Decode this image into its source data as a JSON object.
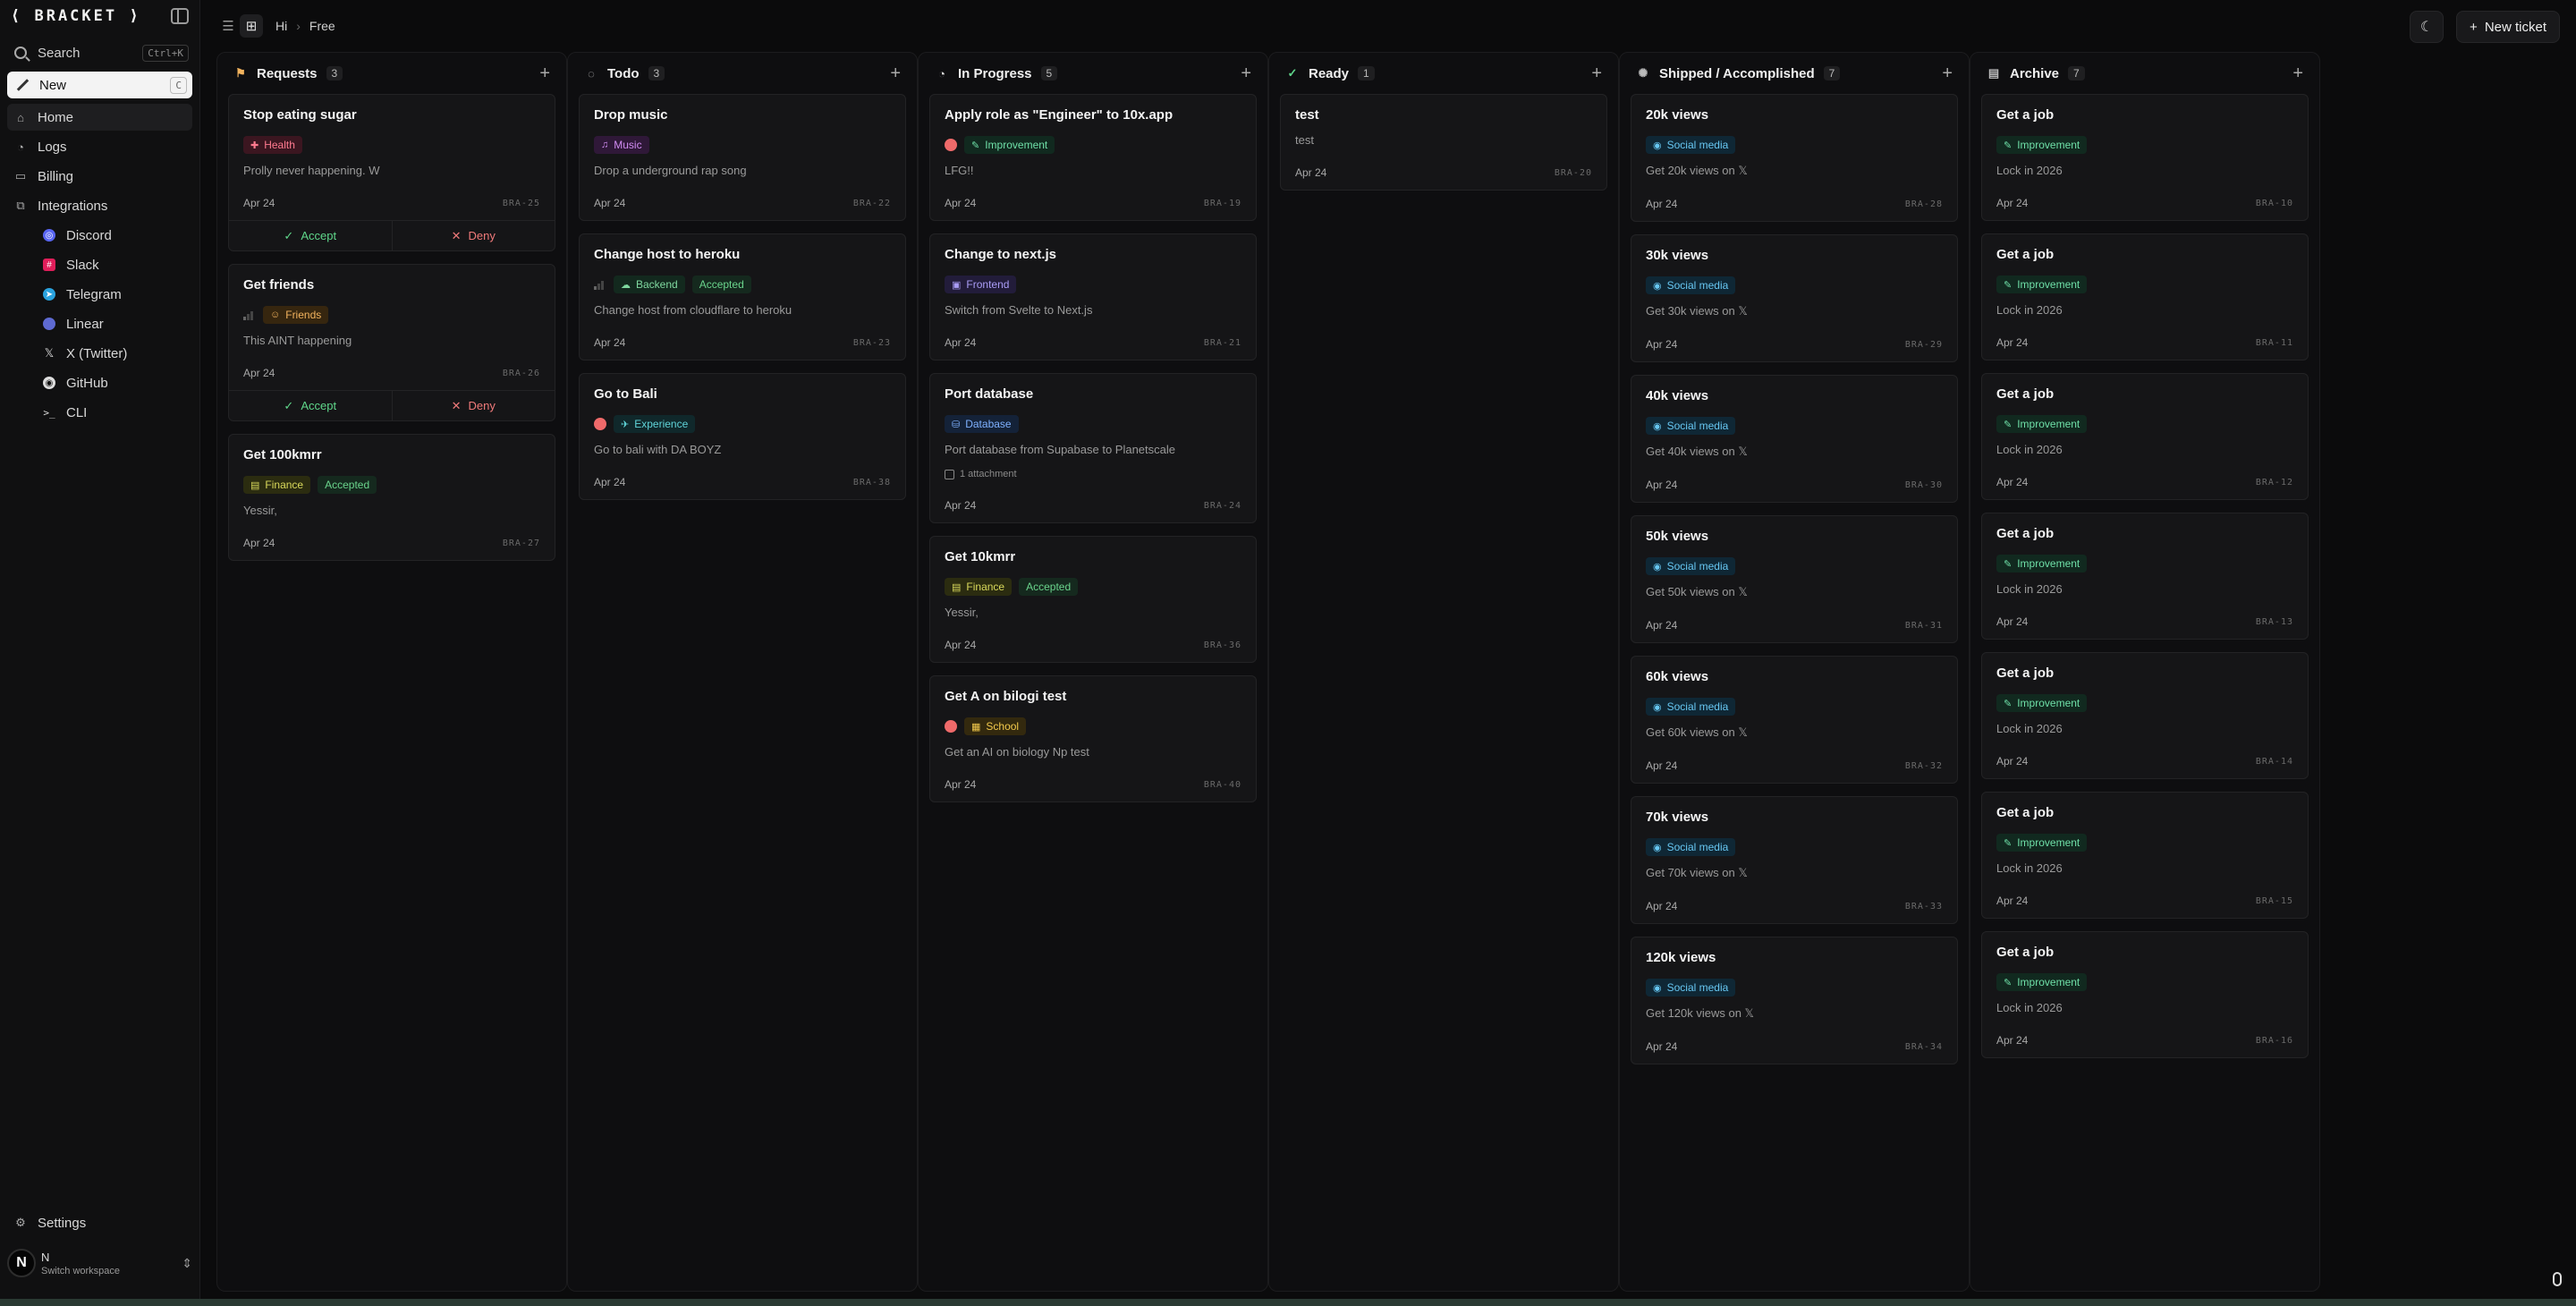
{
  "brand": "⟨ BRACKET ⟩",
  "sidebar": {
    "search_label": "Search",
    "search_kbd": "Ctrl+K",
    "new_label": "New",
    "new_kbd": "C",
    "nav": [
      {
        "label": "Home",
        "icon": "home-icon"
      },
      {
        "label": "Logs",
        "icon": "logs-icon"
      },
      {
        "label": "Billing",
        "icon": "billing-icon"
      },
      {
        "label": "Integrations",
        "icon": "integrations-icon"
      }
    ],
    "integrations": [
      {
        "label": "Discord",
        "icon": "discord-icon",
        "color": "#5865f2"
      },
      {
        "label": "Slack",
        "icon": "slack-icon",
        "color": "#e01e5a"
      },
      {
        "label": "Telegram",
        "icon": "telegram-icon",
        "color": "#2aa3df"
      },
      {
        "label": "Linear",
        "icon": "linear-icon",
        "color": "#5e6ad2"
      },
      {
        "label": "X (Twitter)",
        "icon": "x-icon",
        "color": "#dddddd"
      },
      {
        "label": "GitHub",
        "icon": "github-icon",
        "color": "#dddddd"
      },
      {
        "label": "CLI",
        "icon": "terminal-icon",
        "color": "#dddddd"
      }
    ],
    "settings_label": "Settings",
    "workspace": {
      "avatar": "N",
      "name": "N",
      "sub": "Switch workspace"
    }
  },
  "topbar": {
    "crumbs": [
      "Hi",
      "Free"
    ],
    "new_ticket": "New ticket"
  },
  "columns": [
    {
      "title": "Requests",
      "count": "3",
      "icon": "requests-icon",
      "cards": [
        {
          "title": "Stop eating sugar",
          "prio": "none",
          "tags": [
            {
              "label": "Health",
              "cls": "t-health",
              "icon": "health-icon"
            }
          ],
          "desc": "Prolly never happening. W",
          "date": "Apr 24",
          "id": "BRA-25",
          "accept": "Accept",
          "deny": "Deny"
        },
        {
          "title": "Get friends",
          "prio": "bars",
          "tags": [
            {
              "label": "Friends",
              "cls": "t-friends",
              "icon": "friends-icon"
            }
          ],
          "desc": "This AINT happening",
          "date": "Apr 24",
          "id": "BRA-26",
          "accept": "Accept",
          "deny": "Deny"
        },
        {
          "title": "Get 100kmrr",
          "prio": "none",
          "tags": [
            {
              "label": "Finance",
              "cls": "t-fin",
              "icon": "finance-icon"
            },
            {
              "label": "Accepted",
              "cls": "t-accepted"
            }
          ],
          "desc": "Yessir,",
          "date": "Apr 24",
          "id": "BRA-27"
        }
      ]
    },
    {
      "title": "Todo",
      "count": "3",
      "icon": "todo-icon",
      "cards": [
        {
          "title": "Drop music",
          "prio": "none",
          "tags": [
            {
              "label": "Music",
              "cls": "t-music",
              "icon": "music-icon"
            }
          ],
          "desc": "Drop a underground rap song",
          "date": "Apr 24",
          "id": "BRA-22"
        },
        {
          "title": "Change host to heroku",
          "prio": "bars",
          "tags": [
            {
              "label": "Backend",
              "cls": "t-backend",
              "icon": "backend-icon"
            },
            {
              "label": "Accepted",
              "cls": "t-accepted"
            }
          ],
          "desc": "Change host from cloudflare to heroku",
          "date": "Apr 24",
          "id": "BRA-23"
        },
        {
          "title": "Go to Bali",
          "prio": "red",
          "tags": [
            {
              "label": "Experience",
              "cls": "t-exp",
              "icon": "experience-icon"
            }
          ],
          "desc": "Go to bali with DA BOYZ",
          "date": "Apr 24",
          "id": "BRA-38"
        }
      ]
    },
    {
      "title": "In Progress",
      "count": "5",
      "icon": "in-progress-icon",
      "cards": [
        {
          "title": "Apply role as \"Engineer\" to 10x.app",
          "prio": "red",
          "tags": [
            {
              "label": "Improvement",
              "cls": "t-impr",
              "icon": "wrench-icon"
            }
          ],
          "desc": "LFG!!",
          "date": "Apr 24",
          "id": "BRA-19"
        },
        {
          "title": "Change to next.js",
          "prio": "none",
          "tags": [
            {
              "label": "Frontend",
              "cls": "t-frontend",
              "icon": "frontend-icon"
            }
          ],
          "desc": "Switch from Svelte to Next.js",
          "date": "Apr 24",
          "id": "BRA-21"
        },
        {
          "title": "Port database",
          "prio": "none",
          "tags": [
            {
              "label": "Database",
              "cls": "t-db",
              "icon": "database-icon"
            }
          ],
          "desc": "Port database from Supabase to Planetscale",
          "attachment": "1 attachment",
          "date": "Apr 24",
          "id": "BRA-24"
        },
        {
          "title": "Get 10kmrr",
          "prio": "none",
          "tags": [
            {
              "label": "Finance",
              "cls": "t-fin",
              "icon": "finance-icon"
            },
            {
              "label": "Accepted",
              "cls": "t-accepted"
            }
          ],
          "desc": "Yessir,",
          "date": "Apr 24",
          "id": "BRA-36"
        },
        {
          "title": "Get A on bilogi test",
          "prio": "red",
          "tags": [
            {
              "label": "School",
              "cls": "t-school",
              "icon": "school-icon"
            }
          ],
          "desc": "Get an AI on biology Np test",
          "date": "Apr 24",
          "id": "BRA-40"
        }
      ]
    },
    {
      "title": "Ready",
      "count": "1",
      "icon": "ready-icon",
      "cards": [
        {
          "title": "test",
          "prio": "none",
          "tags": [],
          "desc": "test",
          "date": "Apr 24",
          "id": "BRA-20"
        }
      ]
    },
    {
      "title": "Shipped / Accomplished",
      "count": "7",
      "icon": "shipped-icon",
      "cards": [
        {
          "title": "20k views",
          "prio": "none",
          "tags": [
            {
              "label": "Social media",
              "cls": "t-social",
              "icon": "social-icon"
            }
          ],
          "desc": "Get 20k views on 𝕏",
          "date": "Apr 24",
          "id": "BRA-28"
        },
        {
          "title": "30k views",
          "prio": "none",
          "tags": [
            {
              "label": "Social media",
              "cls": "t-social",
              "icon": "social-icon"
            }
          ],
          "desc": "Get 30k views on 𝕏",
          "date": "Apr 24",
          "id": "BRA-29"
        },
        {
          "title": "40k views",
          "prio": "none",
          "tags": [
            {
              "label": "Social media",
              "cls": "t-social",
              "icon": "social-icon"
            }
          ],
          "desc": "Get 40k views on 𝕏",
          "date": "Apr 24",
          "id": "BRA-30"
        },
        {
          "title": "50k views",
          "prio": "none",
          "tags": [
            {
              "label": "Social media",
              "cls": "t-social",
              "icon": "social-icon"
            }
          ],
          "desc": "Get 50k views on 𝕏",
          "date": "Apr 24",
          "id": "BRA-31"
        },
        {
          "title": "60k views",
          "prio": "none",
          "tags": [
            {
              "label": "Social media",
              "cls": "t-social",
              "icon": "social-icon"
            }
          ],
          "desc": "Get 60k views on 𝕏",
          "date": "Apr 24",
          "id": "BRA-32"
        },
        {
          "title": "70k views",
          "prio": "none",
          "tags": [
            {
              "label": "Social media",
              "cls": "t-social",
              "icon": "social-icon"
            }
          ],
          "desc": "Get 70k views on 𝕏",
          "date": "Apr 24",
          "id": "BRA-33"
        },
        {
          "title": "120k views",
          "prio": "none",
          "tags": [
            {
              "label": "Social media",
              "cls": "t-social",
              "icon": "social-icon"
            }
          ],
          "desc": "Get 120k views on 𝕏",
          "date": "Apr 24",
          "id": "BRA-34"
        }
      ]
    },
    {
      "title": "Archive",
      "count": "7",
      "icon": "archive-icon",
      "cards": [
        {
          "title": "Get a job",
          "prio": "none",
          "tags": [
            {
              "label": "Improvement",
              "cls": "t-impr",
              "icon": "wrench-icon"
            }
          ],
          "desc": "Lock in 2026",
          "date": "Apr 24",
          "id": "BRA-10"
        },
        {
          "title": "Get a job",
          "prio": "none",
          "tags": [
            {
              "label": "Improvement",
              "cls": "t-impr",
              "icon": "wrench-icon"
            }
          ],
          "desc": "Lock in 2026",
          "date": "Apr 24",
          "id": "BRA-11"
        },
        {
          "title": "Get a job",
          "prio": "none",
          "tags": [
            {
              "label": "Improvement",
              "cls": "t-impr",
              "icon": "wrench-icon"
            }
          ],
          "desc": "Lock in 2026",
          "date": "Apr 24",
          "id": "BRA-12"
        },
        {
          "title": "Get a job",
          "prio": "none",
          "tags": [
            {
              "label": "Improvement",
              "cls": "t-impr",
              "icon": "wrench-icon"
            }
          ],
          "desc": "Lock in 2026",
          "date": "Apr 24",
          "id": "BRA-13"
        },
        {
          "title": "Get a job",
          "prio": "none",
          "tags": [
            {
              "label": "Improvement",
              "cls": "t-impr",
              "icon": "wrench-icon"
            }
          ],
          "desc": "Lock in 2026",
          "date": "Apr 24",
          "id": "BRA-14"
        },
        {
          "title": "Get a job",
          "prio": "none",
          "tags": [
            {
              "label": "Improvement",
              "cls": "t-impr",
              "icon": "wrench-icon"
            }
          ],
          "desc": "Lock in 2026",
          "date": "Apr 24",
          "id": "BRA-15"
        },
        {
          "title": "Get a job",
          "prio": "none",
          "tags": [
            {
              "label": "Improvement",
              "cls": "t-impr",
              "icon": "wrench-icon"
            }
          ],
          "desc": "Lock in 2026",
          "date": "Apr 24",
          "id": "BRA-16"
        }
      ]
    }
  ]
}
